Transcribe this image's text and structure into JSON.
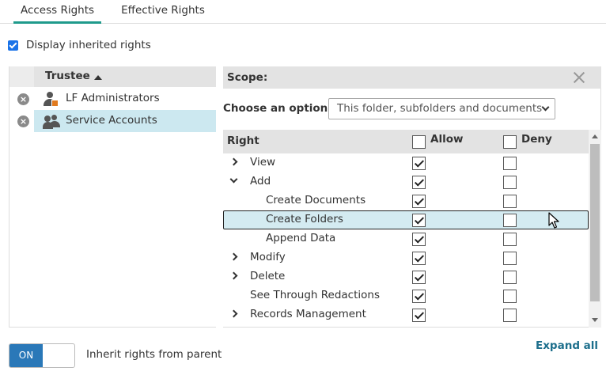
{
  "tabs": [
    {
      "label": "Access Rights",
      "active": true
    },
    {
      "label": "Effective Rights",
      "active": false
    }
  ],
  "inherited": {
    "label": "Display inherited rights",
    "checked": true
  },
  "trustee_panel": {
    "header": "Trustee",
    "sort": "ascending",
    "rows": [
      {
        "name": "LF Administrators",
        "icon": "user-icon",
        "selected": false
      },
      {
        "name": "Service Accounts",
        "icon": "group-icon",
        "selected": true
      }
    ]
  },
  "scope_panel": {
    "title": "Scope:",
    "option_label": "Choose an option:",
    "option_value": "This folder, subfolders and documents",
    "columns": {
      "right": "Right",
      "allow": "Allow",
      "deny": "Deny"
    },
    "rights": [
      {
        "label": "View",
        "expander": "collapsed",
        "allow": true,
        "deny": false
      },
      {
        "label": "Add",
        "expander": "expanded",
        "allow": true,
        "deny": false
      },
      {
        "label": "Create Documents",
        "expander": "none",
        "allow": true,
        "deny": false
      },
      {
        "label": "Create Folders",
        "expander": "none",
        "allow": true,
        "deny": false,
        "selected": true
      },
      {
        "label": "Append Data",
        "expander": "none",
        "allow": true,
        "deny": false
      },
      {
        "label": "Modify",
        "expander": "collapsed",
        "allow": true,
        "deny": false
      },
      {
        "label": "Delete",
        "expander": "collapsed",
        "allow": true,
        "deny": false
      },
      {
        "label": "See Through Redactions",
        "expander": "none",
        "allow": true,
        "deny": false
      },
      {
        "label": "Records Management",
        "expander": "collapsed",
        "allow": true,
        "deny": false
      }
    ]
  },
  "footer": {
    "toggle": "ON",
    "toggle_label": "Inherit rights from parent",
    "expand_all": "Expand all"
  },
  "colors": {
    "accent": "#1f9a8c",
    "selection": "#cce8f0",
    "toggle": "#2a78b8",
    "link": "#1d6f8c"
  }
}
